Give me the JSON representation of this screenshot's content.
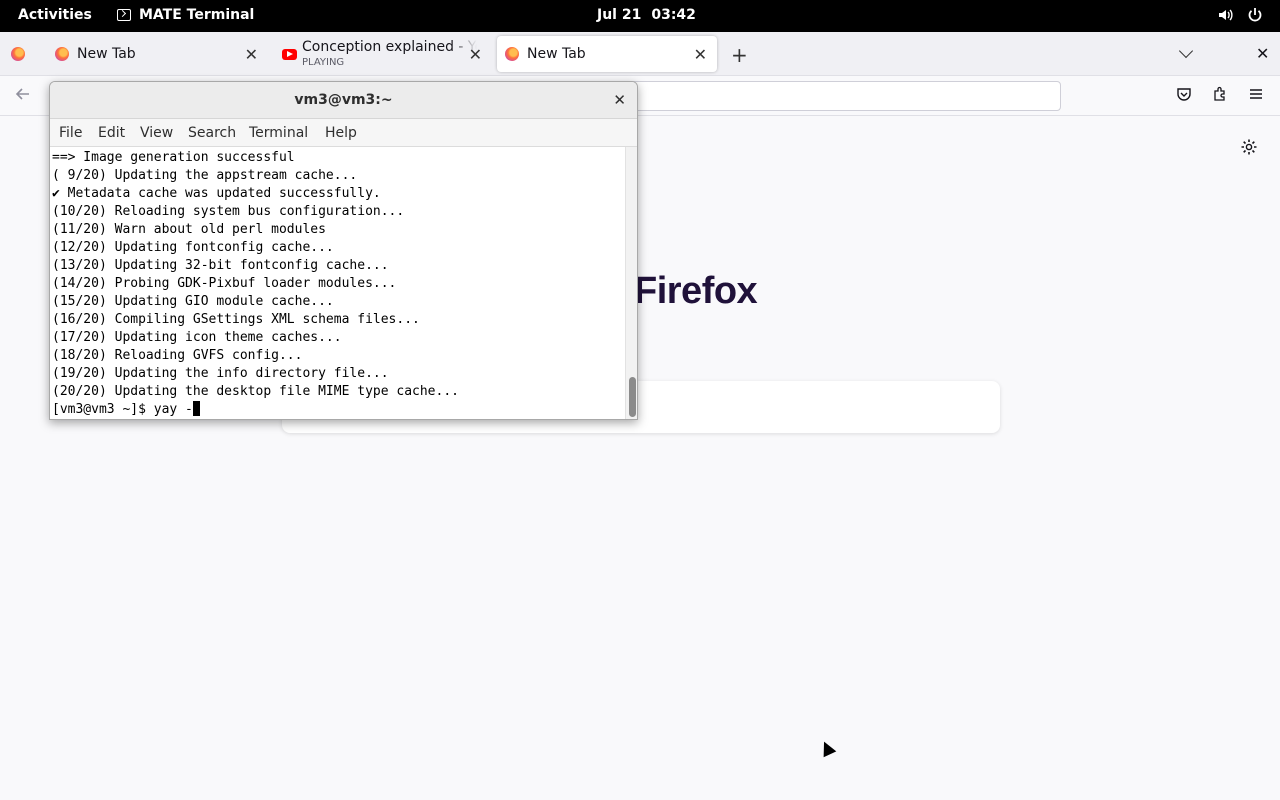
{
  "topbar": {
    "activities": "Activities",
    "app_name": "MATE Terminal",
    "date": "Jul 21",
    "time": "03:42",
    "volume_icon": "volume-icon",
    "power_icon": "power-icon"
  },
  "browser": {
    "tabs": [
      {
        "title": "New Tab",
        "icon": "firefox-icon"
      },
      {
        "title": "Conception explained - YouTube",
        "subtitle": "PLAYING",
        "icon": "youtube-icon"
      },
      {
        "title": "New Tab",
        "icon": "firefox-icon",
        "active": true
      }
    ],
    "brand_wordmark": "Firefox"
  },
  "terminal": {
    "title": "vm3@vm3:~",
    "menu": [
      "File",
      "Edit",
      "View",
      "Search",
      "Terminal",
      "Help"
    ],
    "lines": [
      "==> Image generation successful",
      "( 9/20) Updating the appstream cache...",
      "✔ Metadata cache was updated successfully.",
      "(10/20) Reloading system bus configuration...",
      "(11/20) Warn about old perl modules",
      "(12/20) Updating fontconfig cache...",
      "(13/20) Updating 32-bit fontconfig cache...",
      "(14/20) Probing GDK-Pixbuf loader modules...",
      "(15/20) Updating GIO module cache...",
      "(16/20) Compiling GSettings XML schema files...",
      "(17/20) Updating icon theme caches...",
      "(18/20) Reloading GVFS config...",
      "(19/20) Updating the info directory file...",
      "(20/20) Updating the desktop file MIME type cache..."
    ],
    "prompt": "[vm3@vm3 ~]$ yay -"
  }
}
